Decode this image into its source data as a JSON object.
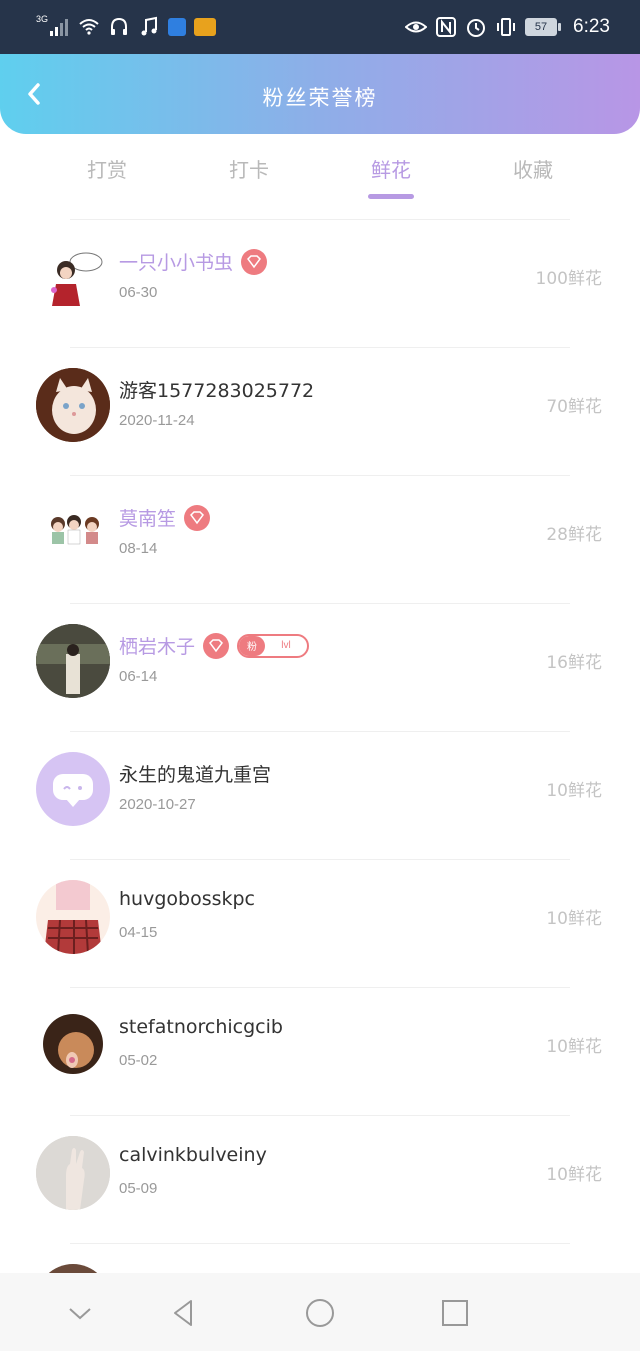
{
  "status_bar": {
    "network": "3G",
    "battery": "57",
    "time": "6:23",
    "icons_left": [
      "signal-icon",
      "wifi-icon",
      "headset-icon",
      "music-icon",
      "shield-app-icon",
      "weibo-icon"
    ],
    "icons_right": [
      "eye-icon",
      "nfc-icon",
      "alarm-icon",
      "vibrate-icon",
      "battery-icon"
    ]
  },
  "header": {
    "title": "粉丝荣誉榜",
    "back_icon": "chevron-left-icon",
    "gradient": [
      "#5fcfee",
      "#b896e6"
    ]
  },
  "tabs": [
    {
      "label": "打赏",
      "active": false
    },
    {
      "label": "打卡",
      "active": false
    },
    {
      "label": "鲜花",
      "active": true
    },
    {
      "label": "收藏",
      "active": false
    }
  ],
  "accent_color": "#b79ae3",
  "badge_color": "#ee7b80",
  "fan_badge": {
    "prefix": "粉",
    "level": "lvl"
  },
  "fans": [
    {
      "name": "一只小小书虫",
      "date": "06-30",
      "amount": "100鲜花",
      "vip": true
    },
    {
      "name": "游客1577283025772",
      "date": "2020-11-24",
      "amount": "70鲜花",
      "vip": false
    },
    {
      "name": "莫南笙",
      "date": "08-14",
      "amount": "28鲜花",
      "vip": true
    },
    {
      "name": "栖岩木子",
      "date": "06-14",
      "amount": "16鲜花",
      "vip": true
    },
    {
      "name": "永生的鬼道九重宫",
      "date": "2020-10-27",
      "amount": "10鲜花",
      "vip": false
    },
    {
      "name": "huvgobosskpc",
      "date": "04-15",
      "amount": "10鲜花",
      "vip": false
    },
    {
      "name": "stefatnorchicgcib",
      "date": "05-02",
      "amount": "10鲜花",
      "vip": false
    },
    {
      "name": "calvinkbulveiny",
      "date": "05-09",
      "amount": "10鲜花",
      "vip": false
    }
  ],
  "nav_bar": [
    "chevron-down-icon",
    "back-triangle-icon",
    "home-circle-icon",
    "recents-square-icon"
  ]
}
